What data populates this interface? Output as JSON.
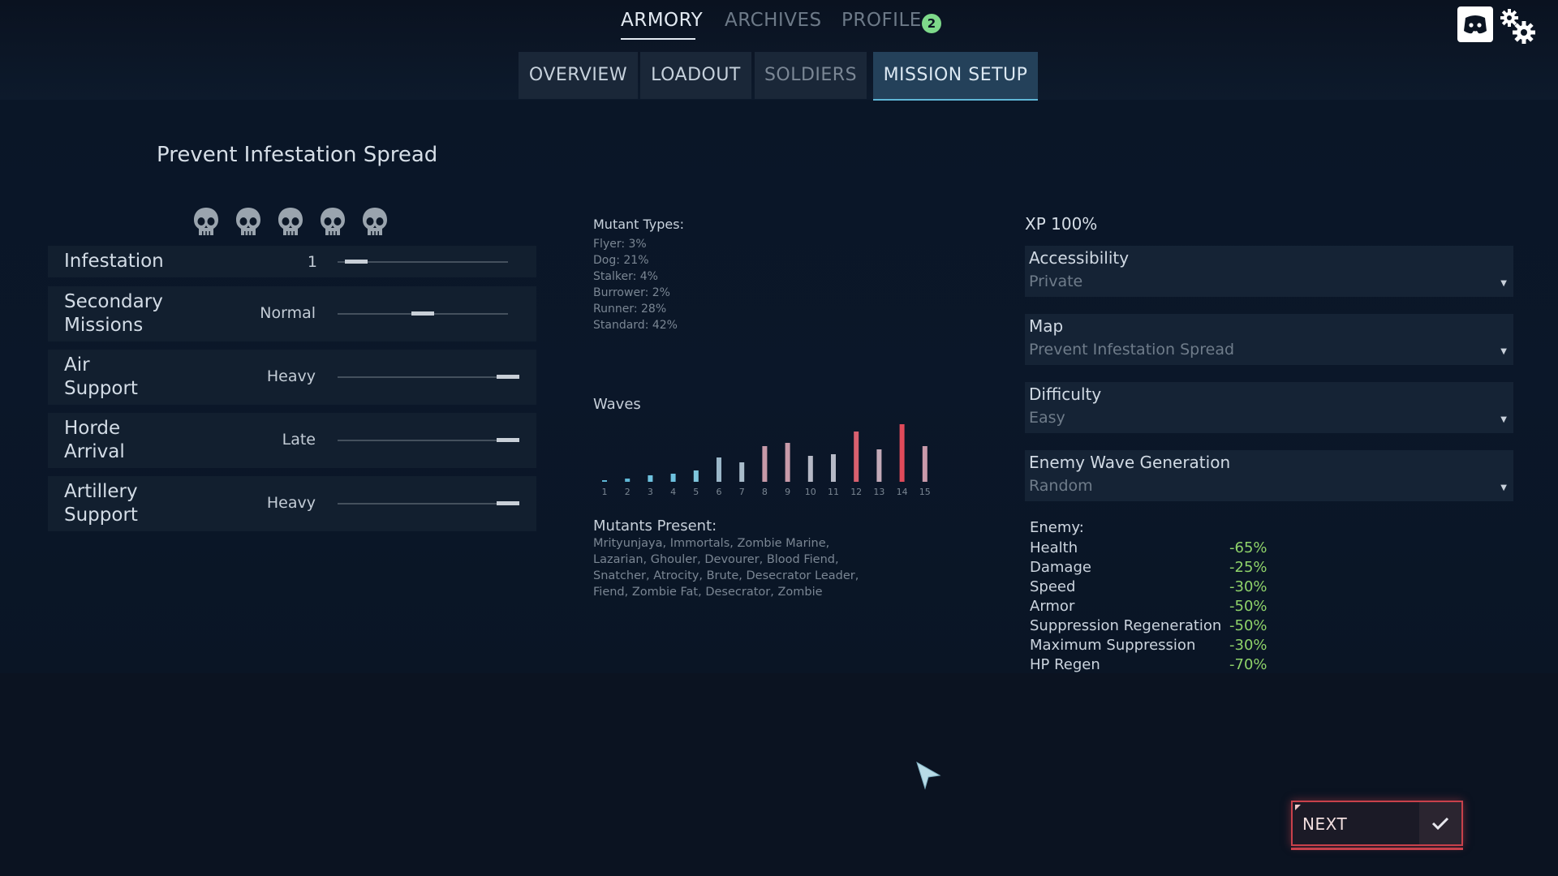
{
  "topnav": {
    "items": [
      {
        "label": "ARMORY",
        "active": true
      },
      {
        "label": "ARCHIVES",
        "active": false
      },
      {
        "label": "PROFILE",
        "active": false,
        "badge": "2"
      }
    ]
  },
  "tabs": [
    {
      "label": "OVERVIEW"
    },
    {
      "label": "LOADOUT"
    },
    {
      "label": "SOLDIERS"
    },
    {
      "label": "MISSION SETUP",
      "active": true
    }
  ],
  "icons": {
    "discord": "discord-icon",
    "settings": "gear-icon"
  },
  "mission": {
    "title": "Prevent Infestation Spread",
    "skull_count": 5
  },
  "settings": [
    {
      "label": "Infestation",
      "value": "1",
      "level": 0.05
    },
    {
      "label": "Secondary\nMissions",
      "value": "Normal",
      "level": 0.5
    },
    {
      "label": "Air\nSupport",
      "value": "Heavy",
      "level": 1.0
    },
    {
      "label": "Horde\nArrival",
      "value": "Late",
      "level": 1.0
    },
    {
      "label": "Artillery\nSupport",
      "value": "Heavy",
      "level": 1.0
    }
  ],
  "mutant_types": {
    "heading": "Mutant Types:",
    "items": [
      "Flyer:  3%",
      "Dog:  21%",
      "Stalker:  4%",
      "Burrower:  2%",
      "Runner:  28%",
      "Standard:  42%"
    ]
  },
  "waves": {
    "heading": "Waves",
    "labels": [
      "1",
      "2",
      "3",
      "4",
      "5",
      "6",
      "7",
      "8",
      "9",
      "10",
      "11",
      "12",
      "13",
      "14",
      "15"
    ],
    "values": [
      2,
      4,
      8,
      10,
      14,
      30,
      24,
      44,
      48,
      32,
      34,
      62,
      40,
      71,
      44
    ],
    "colors": [
      "#5fb7d6",
      "#5fb7d6",
      "#6ec2df",
      "#6ec2df",
      "#7fc6dd",
      "#9bb7c9",
      "#a9bccb",
      "#c89aa9",
      "#c89aa9",
      "#b6b9c6",
      "#b6b9c6",
      "#d9606f",
      "#c3aab8",
      "#e04a5a",
      "#c99aab"
    ]
  },
  "mutants_present": {
    "heading": "Mutants Present:",
    "text": "Mrityunjaya, Immortals, Zombie Marine, Lazarian, Ghouler, Devourer, Blood Fiend, Snatcher, Atrocity, Brute, Desecrator Leader, Fiend, Zombie Fat, Desecrator, Zombie"
  },
  "right": {
    "xp": "XP 100%",
    "dropdowns": [
      {
        "label": "Accessibility",
        "value": "Private"
      },
      {
        "label": "Map",
        "value": "Prevent Infestation Spread"
      },
      {
        "label": "Difficulty",
        "value": "Easy"
      },
      {
        "label": "Enemy Wave Generation",
        "value": "Random"
      }
    ],
    "enemy_heading": "Enemy:",
    "enemy_stats": [
      {
        "name": "Health",
        "value": "-65%"
      },
      {
        "name": "Damage",
        "value": "-25%"
      },
      {
        "name": "Speed",
        "value": "-30%"
      },
      {
        "name": "Armor",
        "value": "-50%"
      },
      {
        "name": "Suppression Regeneration",
        "value": "-50%"
      },
      {
        "name": "Maximum Suppression",
        "value": "-30%"
      },
      {
        "name": "HP Regen",
        "value": "-70%"
      }
    ]
  },
  "next_button": {
    "label": "NEXT"
  }
}
